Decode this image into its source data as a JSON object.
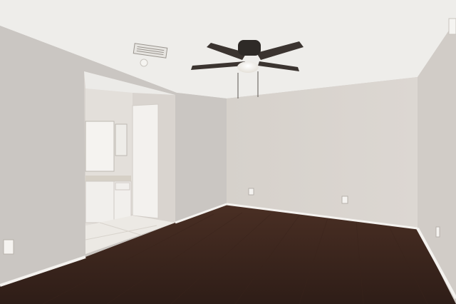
{
  "scene": {
    "subject": "empty-bedroom-interior",
    "elements": [
      "textured-ceiling",
      "ceiling-fan",
      "hvac-vent",
      "smoke-detector",
      "doorway-to-bathroom",
      "bathroom-vanity",
      "vanity-mirror",
      "open-door",
      "tile-floor",
      "hardwood-floor",
      "baseboards",
      "wall-outlets"
    ]
  },
  "colors": {
    "ceiling": "#eeedea",
    "wall_left": "#cac6c2",
    "wall_back": "#d8d3ce",
    "wall_right": "#d1ccc7",
    "floor": "#4a2f24",
    "floor_dark": "#2e1d17",
    "baseboard": "#f4f2ef",
    "fan_body": "#2e2a27",
    "fan_blade": "#3b3430",
    "light_globe": "#f6f4ef",
    "bathroom_wall": "#e3dfda",
    "tile": "#ece9e4",
    "cabinet": "#f1efec",
    "door": "#f3f1ee"
  }
}
